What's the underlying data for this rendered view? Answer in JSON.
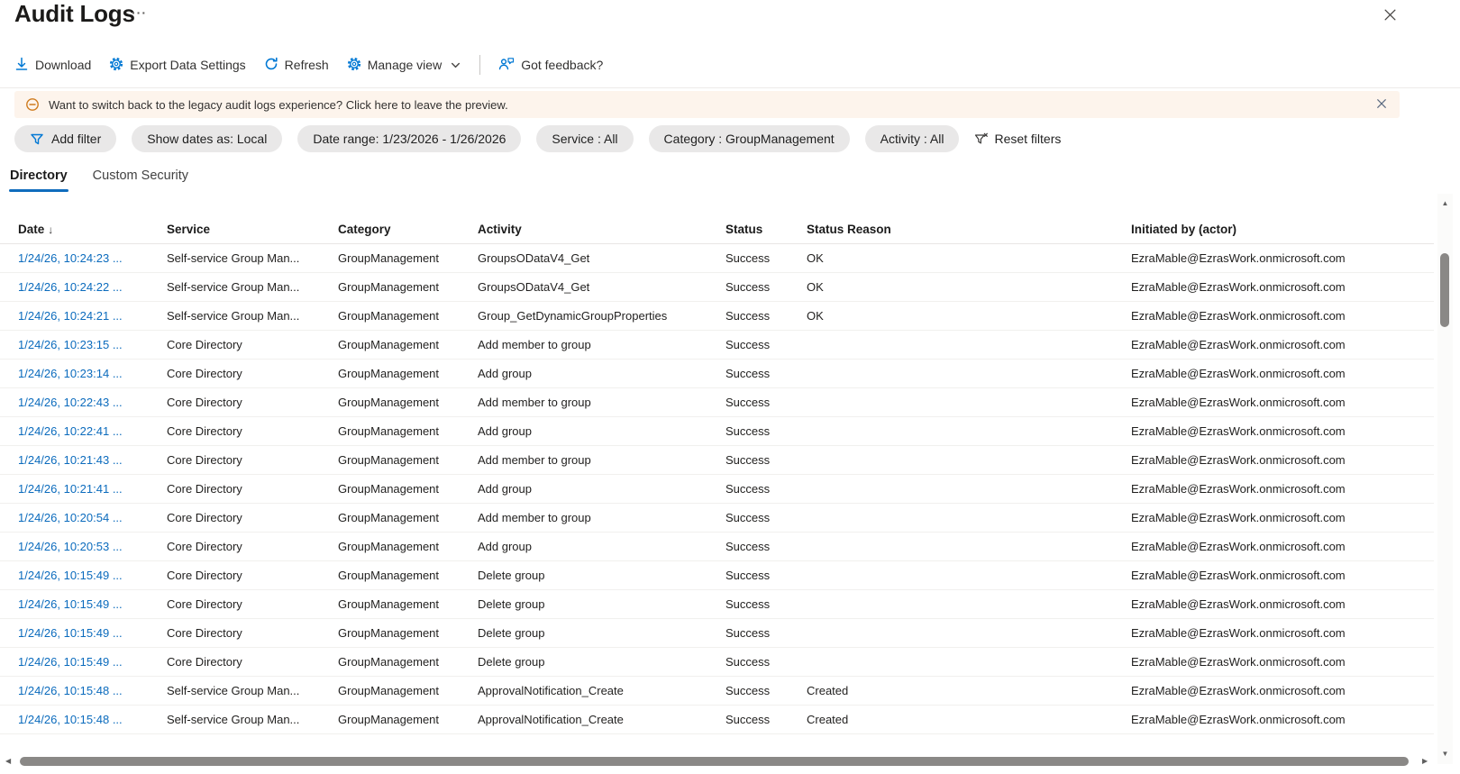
{
  "header": {
    "title": "Audit Logs",
    "more_label": "···"
  },
  "toolbar": {
    "download": "Download",
    "export_data_settings": "Export Data Settings",
    "refresh": "Refresh",
    "manage_view": "Manage view",
    "got_feedback": "Got feedback?"
  },
  "banner": {
    "message": "Want to switch back to the legacy audit logs experience? Click here to leave the preview."
  },
  "filters": {
    "add_filter_label": "Add filter",
    "pills": [
      "Show dates as: Local",
      "Date range: 1/23/2026 - 1/26/2026",
      "Service : All",
      "Category : GroupManagement",
      "Activity : All"
    ],
    "reset_label": "Reset filters"
  },
  "tabs": [
    {
      "label": "Directory",
      "active": true
    },
    {
      "label": "Custom Security",
      "active": false
    }
  ],
  "table": {
    "columns": [
      "Date",
      "Service",
      "Category",
      "Activity",
      "Status",
      "Status Reason",
      "Initiated by (actor)"
    ],
    "sort_column": "Date",
    "sort_indicator": "↓",
    "rows": [
      [
        "1/24/26, 10:24:23 ...",
        "Self-service Group Man...",
        "GroupManagement",
        "GroupsODataV4_Get",
        "Success",
        "OK",
        "EzraMable@EzrasWork.onmicrosoft.com"
      ],
      [
        "1/24/26, 10:24:22 ...",
        "Self-service Group Man...",
        "GroupManagement",
        "GroupsODataV4_Get",
        "Success",
        "OK",
        "EzraMable@EzrasWork.onmicrosoft.com"
      ],
      [
        "1/24/26, 10:24:21 ...",
        "Self-service Group Man...",
        "GroupManagement",
        "Group_GetDynamicGroupProperties",
        "Success",
        "OK",
        "EzraMable@EzrasWork.onmicrosoft.com"
      ],
      [
        "1/24/26, 10:23:15 ...",
        "Core Directory",
        "GroupManagement",
        "Add member to group",
        "Success",
        "",
        "EzraMable@EzrasWork.onmicrosoft.com"
      ],
      [
        "1/24/26, 10:23:14 ...",
        "Core Directory",
        "GroupManagement",
        "Add group",
        "Success",
        "",
        "EzraMable@EzrasWork.onmicrosoft.com"
      ],
      [
        "1/24/26, 10:22:43 ...",
        "Core Directory",
        "GroupManagement",
        "Add member to group",
        "Success",
        "",
        "EzraMable@EzrasWork.onmicrosoft.com"
      ],
      [
        "1/24/26, 10:22:41 ...",
        "Core Directory",
        "GroupManagement",
        "Add group",
        "Success",
        "",
        "EzraMable@EzrasWork.onmicrosoft.com"
      ],
      [
        "1/24/26, 10:21:43 ...",
        "Core Directory",
        "GroupManagement",
        "Add member to group",
        "Success",
        "",
        "EzraMable@EzrasWork.onmicrosoft.com"
      ],
      [
        "1/24/26, 10:21:41 ...",
        "Core Directory",
        "GroupManagement",
        "Add group",
        "Success",
        "",
        "EzraMable@EzrasWork.onmicrosoft.com"
      ],
      [
        "1/24/26, 10:20:54 ...",
        "Core Directory",
        "GroupManagement",
        "Add member to group",
        "Success",
        "",
        "EzraMable@EzrasWork.onmicrosoft.com"
      ],
      [
        "1/24/26, 10:20:53 ...",
        "Core Directory",
        "GroupManagement",
        "Add group",
        "Success",
        "",
        "EzraMable@EzrasWork.onmicrosoft.com"
      ],
      [
        "1/24/26, 10:15:49 ...",
        "Core Directory",
        "GroupManagement",
        "Delete group",
        "Success",
        "",
        "EzraMable@EzrasWork.onmicrosoft.com"
      ],
      [
        "1/24/26, 10:15:49 ...",
        "Core Directory",
        "GroupManagement",
        "Delete group",
        "Success",
        "",
        "EzraMable@EzrasWork.onmicrosoft.com"
      ],
      [
        "1/24/26, 10:15:49 ...",
        "Core Directory",
        "GroupManagement",
        "Delete group",
        "Success",
        "",
        "EzraMable@EzrasWork.onmicrosoft.com"
      ],
      [
        "1/24/26, 10:15:49 ...",
        "Core Directory",
        "GroupManagement",
        "Delete group",
        "Success",
        "",
        "EzraMable@EzrasWork.onmicrosoft.com"
      ],
      [
        "1/24/26, 10:15:48 ...",
        "Self-service Group Man...",
        "GroupManagement",
        "ApprovalNotification_Create",
        "Success",
        "Created",
        "EzraMable@EzrasWork.onmicrosoft.com"
      ],
      [
        "1/24/26, 10:15:48 ...",
        "Self-service Group Man...",
        "GroupManagement",
        "ApprovalNotification_Create",
        "Success",
        "Created",
        "EzraMable@EzrasWork.onmicrosoft.com"
      ]
    ]
  },
  "colors": {
    "accent": "#0078d4",
    "link": "#0b6bbd",
    "tab_underline": "#0f6cbd",
    "banner_bg": "#fdf4ec",
    "banner_icon": "#cf7b1e",
    "pill_bg": "#e9e8e8",
    "scrollbar_thumb": "#8a8886"
  }
}
